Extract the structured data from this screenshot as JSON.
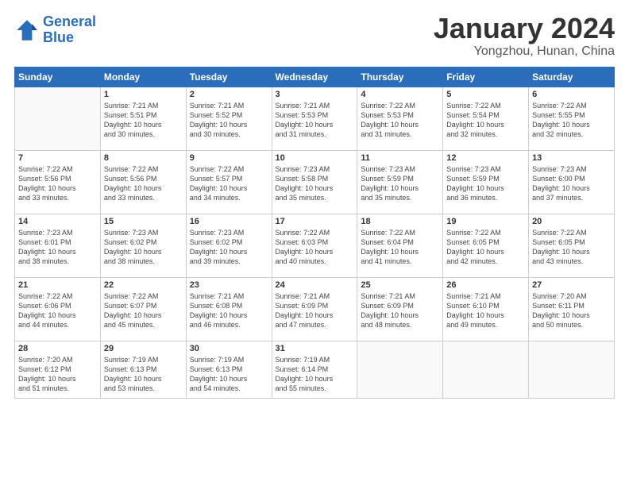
{
  "logo": {
    "line1": "General",
    "line2": "Blue"
  },
  "title": "January 2024",
  "location": "Yongzhou, Hunan, China",
  "headers": [
    "Sunday",
    "Monday",
    "Tuesday",
    "Wednesday",
    "Thursday",
    "Friday",
    "Saturday"
  ],
  "weeks": [
    [
      {
        "day": "",
        "info": ""
      },
      {
        "day": "1",
        "info": "Sunrise: 7:21 AM\nSunset: 5:51 PM\nDaylight: 10 hours\nand 30 minutes."
      },
      {
        "day": "2",
        "info": "Sunrise: 7:21 AM\nSunset: 5:52 PM\nDaylight: 10 hours\nand 30 minutes."
      },
      {
        "day": "3",
        "info": "Sunrise: 7:21 AM\nSunset: 5:53 PM\nDaylight: 10 hours\nand 31 minutes."
      },
      {
        "day": "4",
        "info": "Sunrise: 7:22 AM\nSunset: 5:53 PM\nDaylight: 10 hours\nand 31 minutes."
      },
      {
        "day": "5",
        "info": "Sunrise: 7:22 AM\nSunset: 5:54 PM\nDaylight: 10 hours\nand 32 minutes."
      },
      {
        "day": "6",
        "info": "Sunrise: 7:22 AM\nSunset: 5:55 PM\nDaylight: 10 hours\nand 32 minutes."
      }
    ],
    [
      {
        "day": "7",
        "info": "Sunrise: 7:22 AM\nSunset: 5:56 PM\nDaylight: 10 hours\nand 33 minutes."
      },
      {
        "day": "8",
        "info": "Sunrise: 7:22 AM\nSunset: 5:56 PM\nDaylight: 10 hours\nand 33 minutes."
      },
      {
        "day": "9",
        "info": "Sunrise: 7:22 AM\nSunset: 5:57 PM\nDaylight: 10 hours\nand 34 minutes."
      },
      {
        "day": "10",
        "info": "Sunrise: 7:23 AM\nSunset: 5:58 PM\nDaylight: 10 hours\nand 35 minutes."
      },
      {
        "day": "11",
        "info": "Sunrise: 7:23 AM\nSunset: 5:59 PM\nDaylight: 10 hours\nand 35 minutes."
      },
      {
        "day": "12",
        "info": "Sunrise: 7:23 AM\nSunset: 5:59 PM\nDaylight: 10 hours\nand 36 minutes."
      },
      {
        "day": "13",
        "info": "Sunrise: 7:23 AM\nSunset: 6:00 PM\nDaylight: 10 hours\nand 37 minutes."
      }
    ],
    [
      {
        "day": "14",
        "info": "Sunrise: 7:23 AM\nSunset: 6:01 PM\nDaylight: 10 hours\nand 38 minutes."
      },
      {
        "day": "15",
        "info": "Sunrise: 7:23 AM\nSunset: 6:02 PM\nDaylight: 10 hours\nand 38 minutes."
      },
      {
        "day": "16",
        "info": "Sunrise: 7:23 AM\nSunset: 6:02 PM\nDaylight: 10 hours\nand 39 minutes."
      },
      {
        "day": "17",
        "info": "Sunrise: 7:22 AM\nSunset: 6:03 PM\nDaylight: 10 hours\nand 40 minutes."
      },
      {
        "day": "18",
        "info": "Sunrise: 7:22 AM\nSunset: 6:04 PM\nDaylight: 10 hours\nand 41 minutes."
      },
      {
        "day": "19",
        "info": "Sunrise: 7:22 AM\nSunset: 6:05 PM\nDaylight: 10 hours\nand 42 minutes."
      },
      {
        "day": "20",
        "info": "Sunrise: 7:22 AM\nSunset: 6:05 PM\nDaylight: 10 hours\nand 43 minutes."
      }
    ],
    [
      {
        "day": "21",
        "info": "Sunrise: 7:22 AM\nSunset: 6:06 PM\nDaylight: 10 hours\nand 44 minutes."
      },
      {
        "day": "22",
        "info": "Sunrise: 7:22 AM\nSunset: 6:07 PM\nDaylight: 10 hours\nand 45 minutes."
      },
      {
        "day": "23",
        "info": "Sunrise: 7:21 AM\nSunset: 6:08 PM\nDaylight: 10 hours\nand 46 minutes."
      },
      {
        "day": "24",
        "info": "Sunrise: 7:21 AM\nSunset: 6:09 PM\nDaylight: 10 hours\nand 47 minutes."
      },
      {
        "day": "25",
        "info": "Sunrise: 7:21 AM\nSunset: 6:09 PM\nDaylight: 10 hours\nand 48 minutes."
      },
      {
        "day": "26",
        "info": "Sunrise: 7:21 AM\nSunset: 6:10 PM\nDaylight: 10 hours\nand 49 minutes."
      },
      {
        "day": "27",
        "info": "Sunrise: 7:20 AM\nSunset: 6:11 PM\nDaylight: 10 hours\nand 50 minutes."
      }
    ],
    [
      {
        "day": "28",
        "info": "Sunrise: 7:20 AM\nSunset: 6:12 PM\nDaylight: 10 hours\nand 51 minutes."
      },
      {
        "day": "29",
        "info": "Sunrise: 7:19 AM\nSunset: 6:13 PM\nDaylight: 10 hours\nand 53 minutes."
      },
      {
        "day": "30",
        "info": "Sunrise: 7:19 AM\nSunset: 6:13 PM\nDaylight: 10 hours\nand 54 minutes."
      },
      {
        "day": "31",
        "info": "Sunrise: 7:19 AM\nSunset: 6:14 PM\nDaylight: 10 hours\nand 55 minutes."
      },
      {
        "day": "",
        "info": ""
      },
      {
        "day": "",
        "info": ""
      },
      {
        "day": "",
        "info": ""
      }
    ]
  ]
}
